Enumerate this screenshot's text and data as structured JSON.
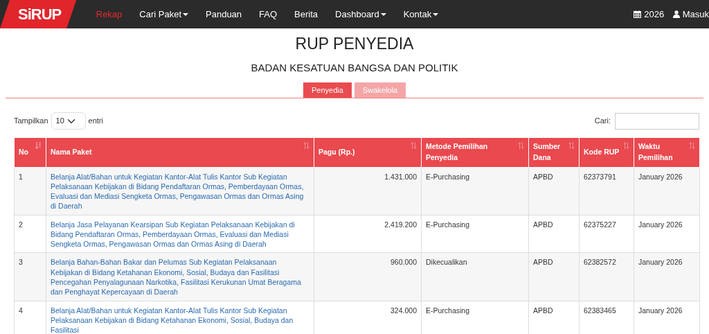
{
  "navbar": {
    "logo": "SiRUP",
    "items": [
      {
        "label": "Rekap",
        "selected": true,
        "dropdown": false
      },
      {
        "label": "Cari Paket",
        "selected": false,
        "dropdown": true
      },
      {
        "label": "Panduan",
        "selected": false,
        "dropdown": false
      },
      {
        "label": "FAQ",
        "selected": false,
        "dropdown": false
      },
      {
        "label": "Berita",
        "selected": false,
        "dropdown": false
      },
      {
        "label": "Dashboard",
        "selected": false,
        "dropdown": true
      },
      {
        "label": "Kontak",
        "selected": false,
        "dropdown": true
      }
    ],
    "right_items": [
      {
        "kind": "calendar",
        "label": "2026"
      },
      {
        "kind": "user",
        "label": "Masuk"
      }
    ]
  },
  "title": "RUP PENYEDIA",
  "subtitle": "BADAN KESATUAN BANGSA DAN POLITIK",
  "tabs": [
    {
      "label": "Penyedia",
      "selected": true
    },
    {
      "label": "Swakelola",
      "selected": false
    }
  ],
  "length_control": {
    "before": "Tampilkan",
    "value": "10",
    "after": "entri"
  },
  "search": {
    "label": "Cari:"
  },
  "table": {
    "columns": [
      {
        "label": "No",
        "sorted": true,
        "kind": "text"
      },
      {
        "label": "Nama Paket",
        "sorted": false,
        "kind": "link"
      },
      {
        "label": "Pagu (Rp.)",
        "sorted": false,
        "kind": "number"
      },
      {
        "label": "Metode Pemilihan Penyedia",
        "sorted": false,
        "kind": "text"
      },
      {
        "label": "Sumber Dana",
        "sorted": false,
        "kind": "text"
      },
      {
        "label": "Kode RUP",
        "sorted": false,
        "kind": "text"
      },
      {
        "label": "Waktu Pemilihan",
        "sorted": false,
        "kind": "text"
      }
    ],
    "rows": [
      [
        "1",
        "Belanja Alat/Bahan untuk Kegiatan Kantor-Alat Tulis Kantor Sub Kegiatan Pelaksanaan Kebijakan di Bidang Pendaftaran Ormas, Pemberdayaan Ormas, Evaluasi dan Mediasi Sengketa Ormas, Pengawasan Ormas dan Ormas Asing di Daerah",
        "1.431.000",
        "E-Purchasing",
        "APBD",
        "62373791",
        "January 2026"
      ],
      [
        "2",
        "Belanja Jasa Pelayanan Kearsipan Sub Kegiatan Pelaksanaan Kebijakan di Bidang Pendaftaran Ormas, Pemberdayaan Ormas, Evaluasi dan Mediasi Sengketa Ormas, Pengawasan Ormas dan Ormas Asing di Daerah",
        "2.419.200",
        "E-Purchasing",
        "APBD",
        "62375227",
        "January 2026"
      ],
      [
        "3",
        "Belanja Bahan-Bahan Bakar dan Pelumas Sub Kegiatan Pelaksanaan Kebijakan di Bidang Ketahanan Ekonomi, Sosial, Budaya dan Fasilitasi Pencegahan Penyalagunaan Narkotika, Fasilitasi Kerukunan Umat Beragama dan Penghayat Kepercayaan di Daerah",
        "960.000",
        "Dikecualikan",
        "APBD",
        "62382572",
        "January 2026"
      ],
      [
        "4",
        "Belanja Alat/Bahan untuk Kegiatan Kantor-Alat Tulis Kantor Sub Kegiatan Pelaksanaan Kebijakan di Bidang Ketahanan Ekonomi, Sosial, Budaya dan Fasilitasi",
        "324.000",
        "E-Purchasing",
        "APBD",
        "62383465",
        "January 2026"
      ]
    ]
  }
}
